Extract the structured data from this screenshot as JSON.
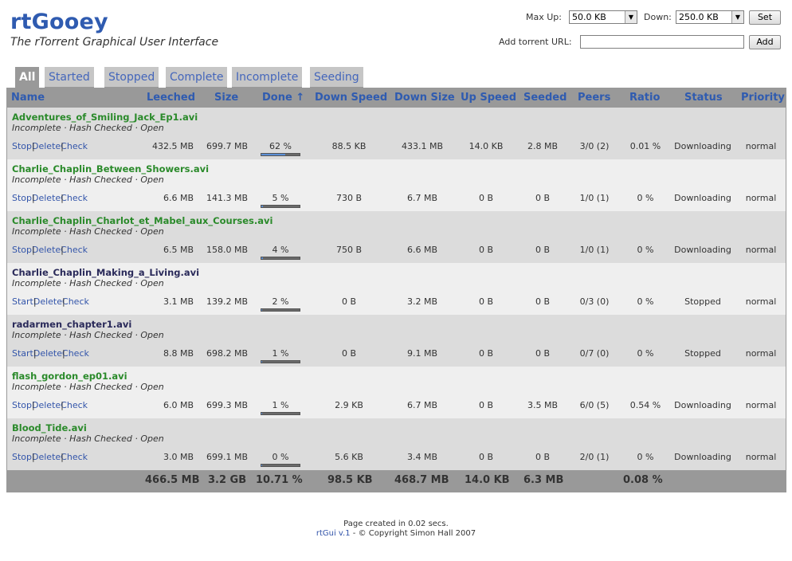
{
  "header": {
    "title": "rtGooey",
    "subtitle": "The rTorrent Graphical User Interface",
    "max_up_label": "Max Up:",
    "max_up_value": "50.0 KB",
    "down_label": "Down:",
    "down_value": "250.0 KB",
    "set_label": "Set",
    "add_url_label": "Add torrent URL:",
    "add_url_value": "",
    "add_label": "Add"
  },
  "tabs": [
    "All",
    "Started",
    "Stopped",
    "Complete",
    "Incomplete",
    "Seeding"
  ],
  "active_tab": "All",
  "columns": [
    "Name",
    "Leeched",
    "Size",
    "Done ↑",
    "Down Speed",
    "Down Size",
    "Up Speed",
    "Seeded",
    "Peers",
    "Ratio",
    "Status",
    "Priority"
  ],
  "torrents": [
    {
      "name": "Adventures_of_Smiling_Jack_Ep1.avi",
      "info": "Incomplete · Hash Checked · Open",
      "action": "Stop",
      "delete": "Delete",
      "check": "Check",
      "leeched": "432.5 MB",
      "size": "699.7 MB",
      "done": "62 %",
      "done_frac": 0.62,
      "down_speed": "88.5 KB",
      "down_size": "433.1 MB",
      "up_speed": "14.0 KB",
      "seeded": "2.8 MB",
      "peers": "3/0 (2)",
      "ratio": "0.01 %",
      "status": "Downloading",
      "priority": "normal",
      "state": "run"
    },
    {
      "name": "Charlie_Chaplin_Between_Showers.avi",
      "info": "Incomplete · Hash Checked · Open",
      "action": "Stop",
      "delete": "Delete",
      "check": "Check",
      "leeched": "6.6 MB",
      "size": "141.3 MB",
      "done": "5 %",
      "done_frac": 0.05,
      "down_speed": "730 B",
      "down_size": "6.7 MB",
      "up_speed": "0 B",
      "seeded": "0 B",
      "peers": "1/0 (1)",
      "ratio": "0 %",
      "status": "Downloading",
      "priority": "normal",
      "state": "run"
    },
    {
      "name": "Charlie_Chaplin_Charlot_et_Mabel_aux_Courses.avi",
      "info": "Incomplete · Hash Checked · Open",
      "action": "Stop",
      "delete": "Delete",
      "check": "Check",
      "leeched": "6.5 MB",
      "size": "158.0 MB",
      "done": "4 %",
      "done_frac": 0.04,
      "down_speed": "750 B",
      "down_size": "6.6 MB",
      "up_speed": "0 B",
      "seeded": "0 B",
      "peers": "1/0 (1)",
      "ratio": "0 %",
      "status": "Downloading",
      "priority": "normal",
      "state": "run"
    },
    {
      "name": "Charlie_Chaplin_Making_a_Living.avi",
      "info": "Incomplete · Hash Checked · Open",
      "action": "Start",
      "delete": "Delete",
      "check": "Check",
      "leeched": "3.1 MB",
      "size": "139.2 MB",
      "done": "2 %",
      "done_frac": 0.02,
      "down_speed": "0 B",
      "down_size": "3.2 MB",
      "up_speed": "0 B",
      "seeded": "0 B",
      "peers": "0/3 (0)",
      "ratio": "0 %",
      "status": "Stopped",
      "priority": "normal",
      "state": "stop"
    },
    {
      "name": "radarmen_chapter1.avi",
      "info": "Incomplete · Hash Checked · Open",
      "action": "Start",
      "delete": "Delete",
      "check": "Check",
      "leeched": "8.8 MB",
      "size": "698.2 MB",
      "done": "1 %",
      "done_frac": 0.01,
      "down_speed": "0 B",
      "down_size": "9.1 MB",
      "up_speed": "0 B",
      "seeded": "0 B",
      "peers": "0/7 (0)",
      "ratio": "0 %",
      "status": "Stopped",
      "priority": "normal",
      "state": "stop"
    },
    {
      "name": "flash_gordon_ep01.avi",
      "info": "Incomplete · Hash Checked · Open",
      "action": "Stop",
      "delete": "Delete",
      "check": "Check",
      "leeched": "6.0 MB",
      "size": "699.3 MB",
      "done": "1 %",
      "done_frac": 0.01,
      "down_speed": "2.9 KB",
      "down_size": "6.7 MB",
      "up_speed": "0 B",
      "seeded": "3.5 MB",
      "peers": "6/0 (5)",
      "ratio": "0.54 %",
      "status": "Downloading",
      "priority": "normal",
      "state": "run"
    },
    {
      "name": "Blood_Tide.avi",
      "info": "Incomplete · Hash Checked · Open",
      "action": "Stop",
      "delete": "Delete",
      "check": "Check",
      "leeched": "3.0 MB",
      "size": "699.1 MB",
      "done": "0 %",
      "done_frac": 0.0,
      "down_speed": "5.6 KB",
      "down_size": "3.4 MB",
      "up_speed": "0 B",
      "seeded": "0 B",
      "peers": "2/0 (1)",
      "ratio": "0 %",
      "status": "Downloading",
      "priority": "normal",
      "state": "run"
    }
  ],
  "totals": {
    "leeched": "466.5 MB",
    "size": "3.2 GB",
    "done": "10.71 %",
    "down_speed": "98.5 KB",
    "down_size": "468.7 MB",
    "up_speed": "14.0 KB",
    "seeded": "6.3 MB",
    "ratio": "0.08 %"
  },
  "footer": {
    "created": "Page created in 0.02 secs.",
    "version_link": "rtGui v.1",
    "copyright": " - © Copyright Simon Hall 2007"
  },
  "colors": {
    "accent": "#2f5bb0",
    "running_name": "#2a8a2a",
    "stopped_name": "#2a2a5a",
    "header_bg": "#999999",
    "progress_fill": "#5b8fd6"
  }
}
